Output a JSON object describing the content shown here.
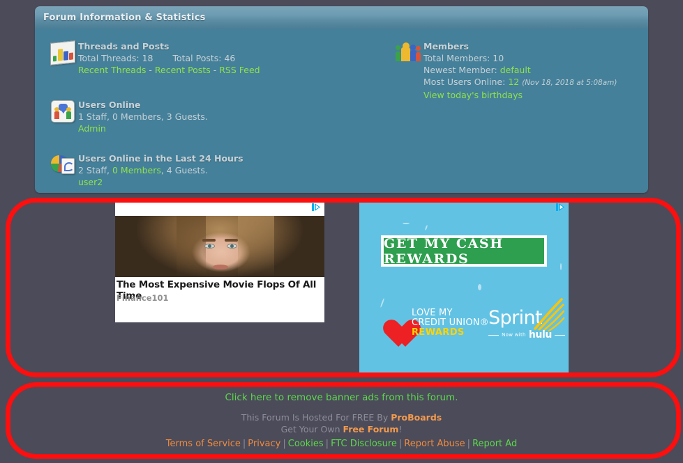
{
  "panel": {
    "title": "Forum Information & Statistics",
    "threads_posts": {
      "heading": "Threads and Posts",
      "total_threads_label": "Total Threads: 18",
      "total_posts_label": "Total Posts: 46",
      "links": [
        {
          "label": "Recent Threads"
        },
        {
          "label": "Recent Posts"
        },
        {
          "label": "RSS Feed"
        }
      ],
      "link_separator": "-",
      "icon": "bar-chart-icon"
    },
    "users_online": {
      "heading": "Users Online",
      "summary": "1 Staff, 0 Members, 3 Guests.",
      "users": [
        {
          "label": "Admin"
        }
      ],
      "icon": "users-online-icon"
    },
    "users_online_24h": {
      "heading": "Users Online in the Last 24 Hours",
      "summary_pre": "2 Staff, ",
      "summary_link": "0 Members",
      "summary_post": ", 4 Guests.",
      "users": [
        {
          "label": "user2"
        }
      ],
      "icon": "pie-chart-page-icon"
    },
    "members": {
      "heading": "Members",
      "total_members_label": "Total Members: 10",
      "newest_member_label": "Newest Member:",
      "newest_member_value": "default",
      "most_users_label": "Most Users Online:",
      "most_users_value": "12",
      "most_users_date": "(Nov 18, 2018 at 5:08am)",
      "birthdays_link": "View today's birthdays",
      "icon": "members-group-icon"
    }
  },
  "ads": {
    "ad_choices_icon": "ad-choices-icon",
    "ad_left": {
      "title": "The Most Expensive Movie Flops Of All Time",
      "source": "Finance101"
    },
    "ad_right": {
      "cta": "GET MY CASH REWARDS",
      "brand_line1": "LOVE MY",
      "brand_line2": "CREDIT UNION®",
      "brand_line3": "REWARDS",
      "carrier": "Sprint",
      "carrier_tagline_pre": "Now with",
      "carrier_tagline_brand": "hulu"
    }
  },
  "footer": {
    "remove_ads_link": "Click here to remove banner ads from this forum.",
    "hosted_pre": "This Forum Is Hosted For FREE By ",
    "hosted_brand": "ProBoards",
    "own_pre": "Get Your Own ",
    "own_brand": "Free Forum",
    "own_post": "!",
    "separator": "|",
    "links": [
      {
        "label": "Terms of Service",
        "color": "orange"
      },
      {
        "label": "Privacy",
        "color": "orange"
      },
      {
        "label": "Cookies",
        "color": "green"
      },
      {
        "label": "FTC Disclosure",
        "color": "green"
      },
      {
        "label": "Report Abuse",
        "color": "orange"
      },
      {
        "label": "Report Ad",
        "color": "green"
      }
    ]
  },
  "highlights": {
    "color": "#fb0f0f",
    "regions": [
      {
        "name": "banner-ads-region"
      },
      {
        "name": "footer-links-region"
      }
    ]
  },
  "colors": {
    "page_background": "#4b4b5a",
    "panel_body": "#45809a",
    "link_green": "#8fe34a",
    "link_orange": "#f08b3c",
    "highlight_red": "#fb0f0f"
  }
}
